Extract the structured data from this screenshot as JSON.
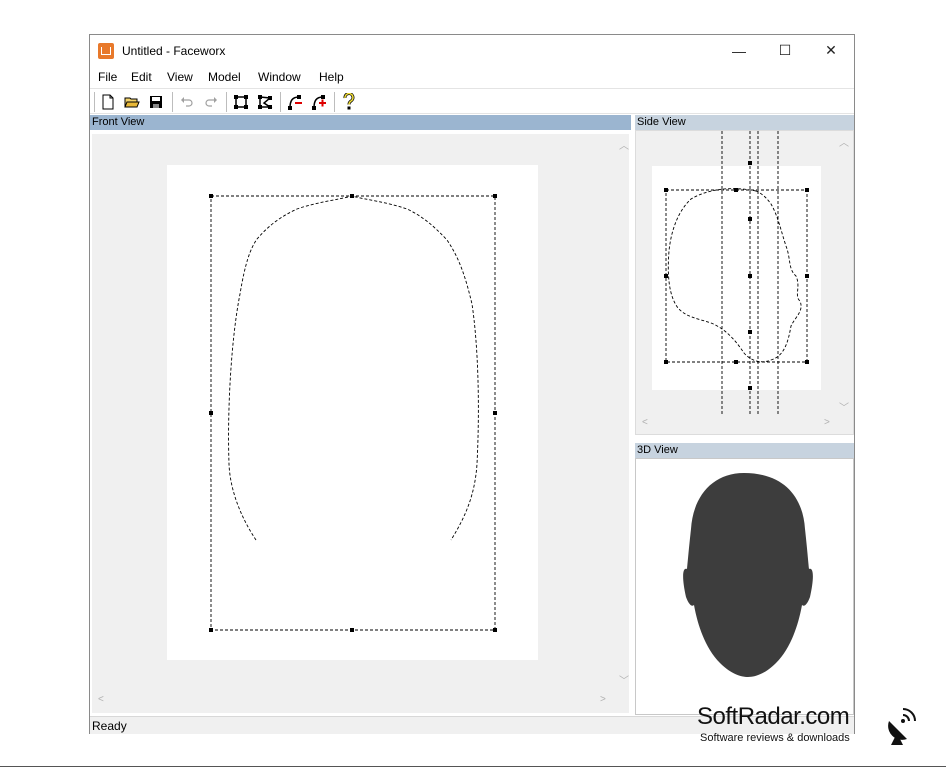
{
  "window": {
    "title": "Untitled - Faceworx",
    "minimize_glyph": "—",
    "maximize_glyph": "☐",
    "close_glyph": "✕"
  },
  "menu": [
    "File",
    "Edit",
    "View",
    "Model",
    "Window",
    "Help"
  ],
  "toolbar": {
    "icons": [
      "new-file-icon",
      "open-folder-icon",
      "save-disk-icon",
      "undo-icon",
      "redo-icon",
      "select-rectangle-icon",
      "select-polygon-icon",
      "add-point-icon",
      "add-feature-point-icon",
      "help-icon"
    ]
  },
  "panes": {
    "front": {
      "title": "Front View"
    },
    "side": {
      "title": "Side View"
    },
    "three_d": {
      "title": "3D View"
    }
  },
  "status": {
    "text": "Ready"
  },
  "watermark": {
    "title": "SoftRadar.com",
    "subtitle": "Software reviews & downloads"
  },
  "colors": {
    "active_header": "#9bb5d0",
    "inactive_header": "#c7d3df",
    "head_fill": "#3d3d3d",
    "canvas_bg": "#f0f0f0"
  }
}
